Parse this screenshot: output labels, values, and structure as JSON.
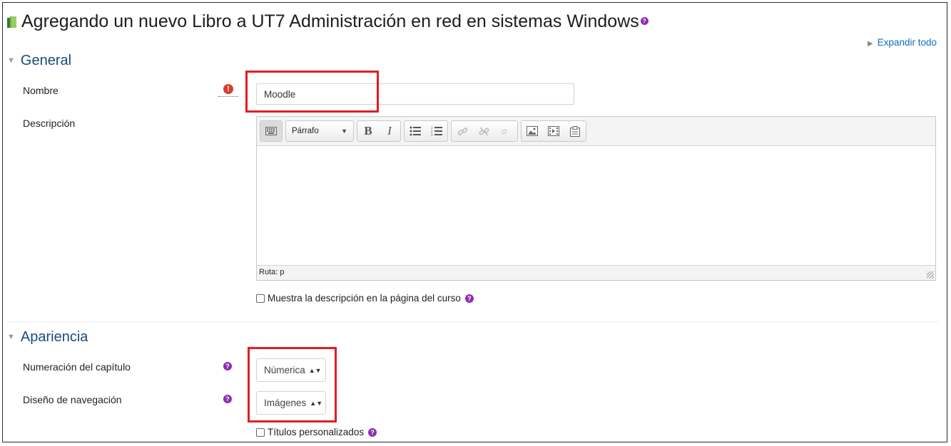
{
  "page": {
    "title": "Agregando un nuevo Libro a UT7 Administración en red en sistemas Windows",
    "expand_all": "Expandir todo"
  },
  "sections": {
    "general": {
      "header": "General",
      "name_label": "Nombre",
      "name_value": "Moodle",
      "description_label": "Descripción",
      "editor": {
        "format_selected": "Párrafo",
        "status_path": "Ruta: p"
      },
      "show_description_label": "Muestra la descripción en la página del curso"
    },
    "appearance": {
      "header": "Apariencia",
      "chapter_numbering_label": "Numeración del capítulo",
      "chapter_numbering_value": "Númerica",
      "navigation_design_label": "Diseño de navegación",
      "navigation_design_value": "Imágenes",
      "custom_titles_label": "Títulos personalizados"
    }
  },
  "colors": {
    "accent_link": "#0f6cbf",
    "section_header": "#1a4b7a",
    "help_icon": "#8e2fb3",
    "required_icon": "#d93d2e",
    "highlight_box": "#e11d22"
  },
  "icons": {
    "book": "book-icon",
    "help": "question-circle-icon",
    "required": "exclamation-circle-icon"
  }
}
